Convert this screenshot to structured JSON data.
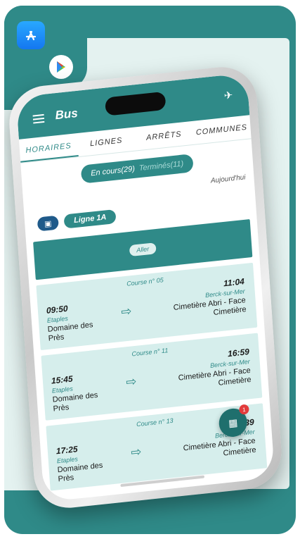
{
  "app": {
    "title": "Bus"
  },
  "tabs": [
    {
      "label": "HORAIRES"
    },
    {
      "label": "LIGNES"
    },
    {
      "label": "ARRÊTS"
    },
    {
      "label": "COMMUNES"
    }
  ],
  "segment": {
    "active": "En cours(29)",
    "inactive": "Terminés(11)"
  },
  "today_label": "Aujourd'hui",
  "line": {
    "bus_icon": "bus-icon",
    "label": "Ligne 1A"
  },
  "direction": {
    "label": "Aller"
  },
  "courses": [
    {
      "title": "Course n° 05",
      "dep_time": "09:50",
      "dep_city": "Etaples",
      "dep_stop": "Domaine des Près",
      "arr_time": "11:04",
      "arr_city": "Berck-sur-Mer",
      "arr_stop": "Cimetière Abri - Face Cimetière"
    },
    {
      "title": "Course n° 11",
      "dep_time": "15:45",
      "dep_city": "Etaples",
      "dep_stop": "Domaine des Près",
      "arr_time": "16:59",
      "arr_city": "Berck-sur-Mer",
      "arr_stop": "Cimetière Abri - Face Cimetière"
    },
    {
      "title": "Course n° 13",
      "dep_time": "17:25",
      "dep_city": "Etaples",
      "dep_stop": "Domaine des Près",
      "arr_time": "18:39",
      "arr_city": "Berck-sur-Mer",
      "arr_stop": "Cimetière Abri - Face Cimetière"
    }
  ],
  "fab": {
    "badge": "1"
  },
  "colors": {
    "primary": "#2f8a88",
    "background": "#e4f2f0",
    "badge_red": "#e23b3b"
  }
}
